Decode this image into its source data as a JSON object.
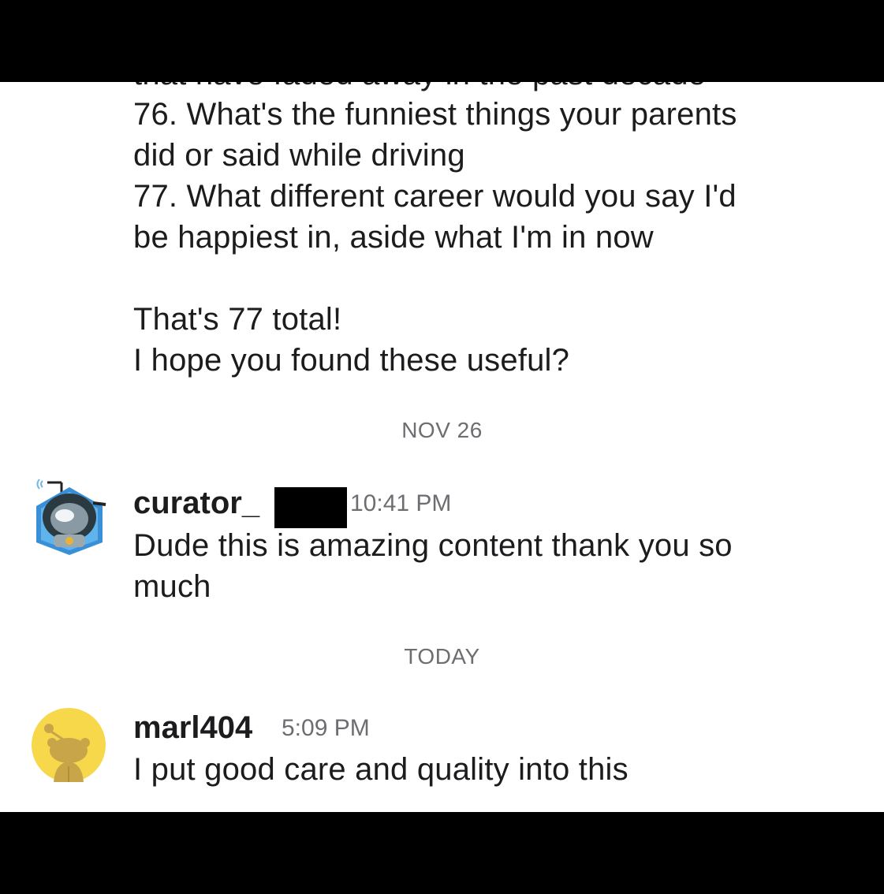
{
  "conversation": {
    "cutoff_line": "that have faded away in the past decade",
    "lines_top": [
      "76. What's the funniest things your parents",
      "did or said while driving",
      "77. What different career would you say I'd",
      "be happiest in, aside what I'm in now"
    ],
    "lines_bottom": [
      "That's 77 total!",
      "I hope you found these useful?"
    ]
  },
  "separators": {
    "first": "NOV 26",
    "second": "TODAY"
  },
  "messages": [
    {
      "username": "curator_",
      "time": "10:41 PM",
      "text_lines": [
        "Dude this is amazing content thank you so",
        "much"
      ],
      "avatar_icon": "robot-astronaut-avatar-icon"
    },
    {
      "username": "marl404",
      "time": "5:09 PM",
      "text_lines": [
        "I put good care and quality into this"
      ],
      "avatar_icon": "snoo-avatar-icon"
    }
  ],
  "colors": {
    "text": "#1c1c1e",
    "meta": "#6d6d72",
    "avatar_yellow": "#f6d84a"
  }
}
